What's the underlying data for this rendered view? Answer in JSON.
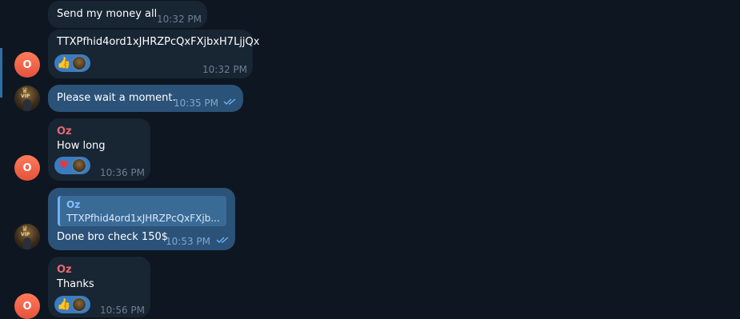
{
  "chat": {
    "messages": [
      {
        "direction": "incoming",
        "text": "Send my money all",
        "time": "10:32 PM"
      },
      {
        "direction": "incoming",
        "text": "TTXPfhid4ord1xJHRZPcQxFXjbxH7LjjQx",
        "time": "10:32 PM",
        "avatar_letter": "O",
        "reaction": {
          "emoji": "👍",
          "icon": "thumbs-up-icon"
        }
      },
      {
        "direction": "outgoing",
        "text": "Please wait a moment.",
        "time": "10:35 PM",
        "status": "read"
      },
      {
        "direction": "incoming",
        "sender": "Oz",
        "text": "How long",
        "time": "10:36 PM",
        "avatar_letter": "O",
        "reaction": {
          "emoji": "♥",
          "icon": "heart-icon",
          "color": "#e8383d"
        }
      },
      {
        "direction": "outgoing",
        "reply": {
          "name": "Oz",
          "text": "TTXPfhid4ord1xJHRZPcQxFXjb..."
        },
        "text": "Done bro check 150$",
        "time": "10:53 PM",
        "status": "read"
      },
      {
        "direction": "incoming",
        "sender": "Oz",
        "text": "Thanks",
        "time": "10:56 PM",
        "avatar_letter": "O",
        "reaction": {
          "emoji": "👍",
          "icon": "thumbs-up-icon"
        }
      }
    ],
    "my_avatar": {
      "badge": "VIP",
      "icon": "crown-icon"
    }
  },
  "colors": {
    "background": "#0e1621",
    "incoming_bubble": "#182533",
    "outgoing_bubble": "#2b5278",
    "sender_name": "#e56a6f",
    "reaction_pill": "#3a7cc0",
    "read_ticks": "#6ab3f3"
  }
}
